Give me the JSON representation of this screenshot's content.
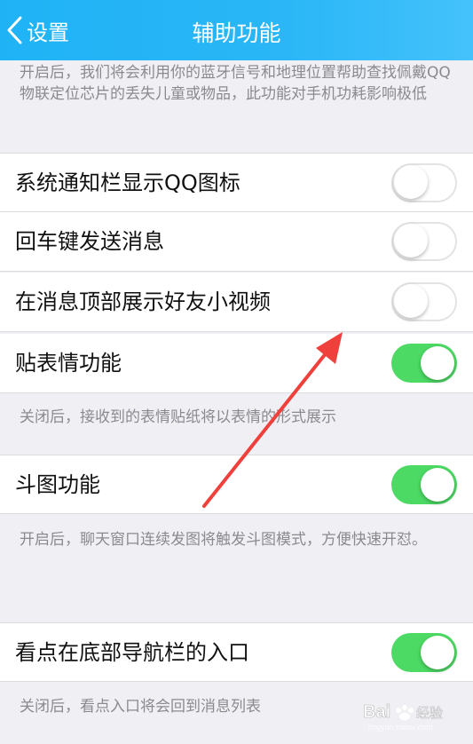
{
  "navbar": {
    "back_label": "设置",
    "title": "辅助功能"
  },
  "top_description": "开启后，我们将会利用你的蓝牙信号和地理位置帮助查找佩戴QQ物联定位芯片的丢失儿童或物品，此功能对手机功耗影响极低",
  "settings": [
    {
      "label": "系统通知栏显示QQ图标",
      "enabled": false
    },
    {
      "label": "回车键发送消息",
      "enabled": false
    },
    {
      "label": "在消息顶部展示好友小视频",
      "enabled": false
    },
    {
      "label": "贴表情功能",
      "enabled": true,
      "description": "关闭后，接收到的表情贴纸将以表情的形式展示"
    },
    {
      "label": "斗图功能",
      "enabled": true,
      "description": "开启后，聊天窗口连续发图将触发斗图模式，方便快速开怼。"
    },
    {
      "label": "看点在底部导航栏的入口",
      "enabled": true,
      "description": "关闭后，看点入口将会回到消息列表"
    }
  ],
  "colors": {
    "navbar": "#2ab6f7",
    "toggle_on": "#4cd964",
    "annotation_arrow": "#f0403c"
  },
  "watermark": {
    "brand": "Bai",
    "sub": "jingyan.baidu.com",
    "cn": "经验"
  }
}
